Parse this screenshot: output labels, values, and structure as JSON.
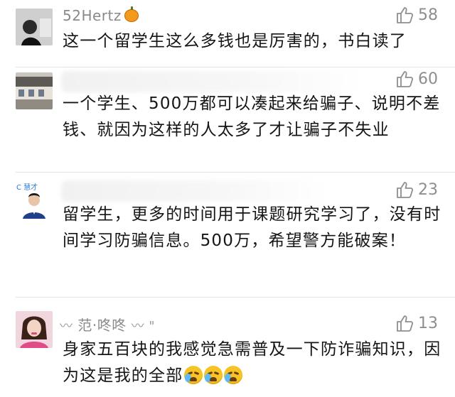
{
  "comments": [
    {
      "username": "52Hertz",
      "likes": "58",
      "text": "这一个留学生这么多钱也是厉害的，书白读了"
    },
    {
      "username": "",
      "likes": "60",
      "text": "一个学生、500万都可以凑起来给骗子、说明不差钱、就因为这样的人太多了才让骗子不失业"
    },
    {
      "username": "",
      "avatar_label": "C 慧才",
      "likes": "23",
      "text": "留学生，更多的时间用于课题研究学习了，没有时间学习防骗信息。500万，希望警方能破案！"
    },
    {
      "username": "范·咚咚",
      "likes": "13",
      "text": "身家五百块的我感觉急需普及一下防诈骗知识，因为这是我的全部"
    }
  ],
  "colors": {
    "text": "#151515",
    "meta": "#8a8a8a",
    "separator": "#e3e3e3"
  },
  "icons": {
    "like": "thumbs-up-outline-icon",
    "user_badge": "pumpkin-icon",
    "emoji": "crying-face-icon"
  }
}
